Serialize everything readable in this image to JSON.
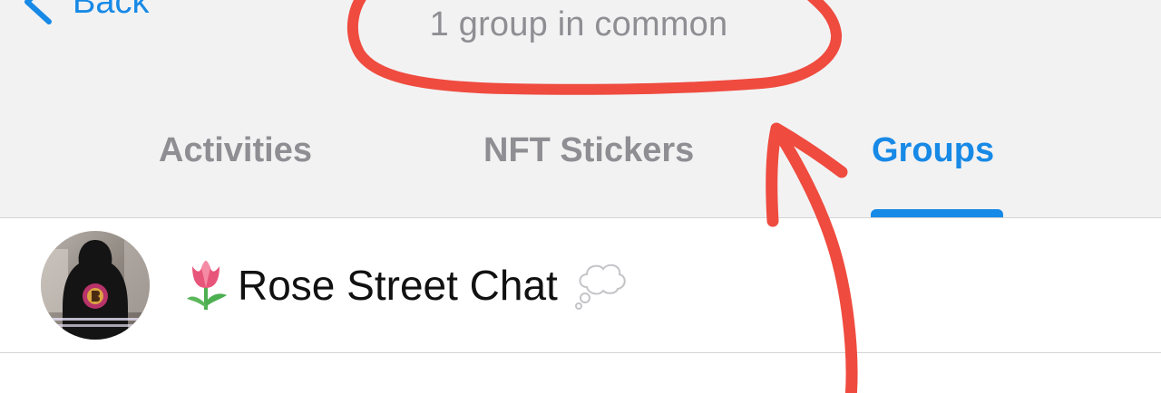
{
  "nav": {
    "back_label": "Back",
    "subtitle": "1 group in common"
  },
  "tabs": [
    {
      "label": "Activities",
      "selected": false
    },
    {
      "label": "NFT Stickers",
      "selected": false
    },
    {
      "label": "Groups",
      "selected": true
    }
  ],
  "groups": [
    {
      "name": "Rose Street Chat",
      "leading_emoji": "tulip-icon",
      "trailing_emoji": "thought-bubble-icon",
      "avatar": "group-avatar"
    }
  ],
  "colors": {
    "accent": "#1789e6",
    "header_bg": "#f2f2f3",
    "inactive_tab": "#8e8e93",
    "annotation": "#ef4b3f"
  }
}
